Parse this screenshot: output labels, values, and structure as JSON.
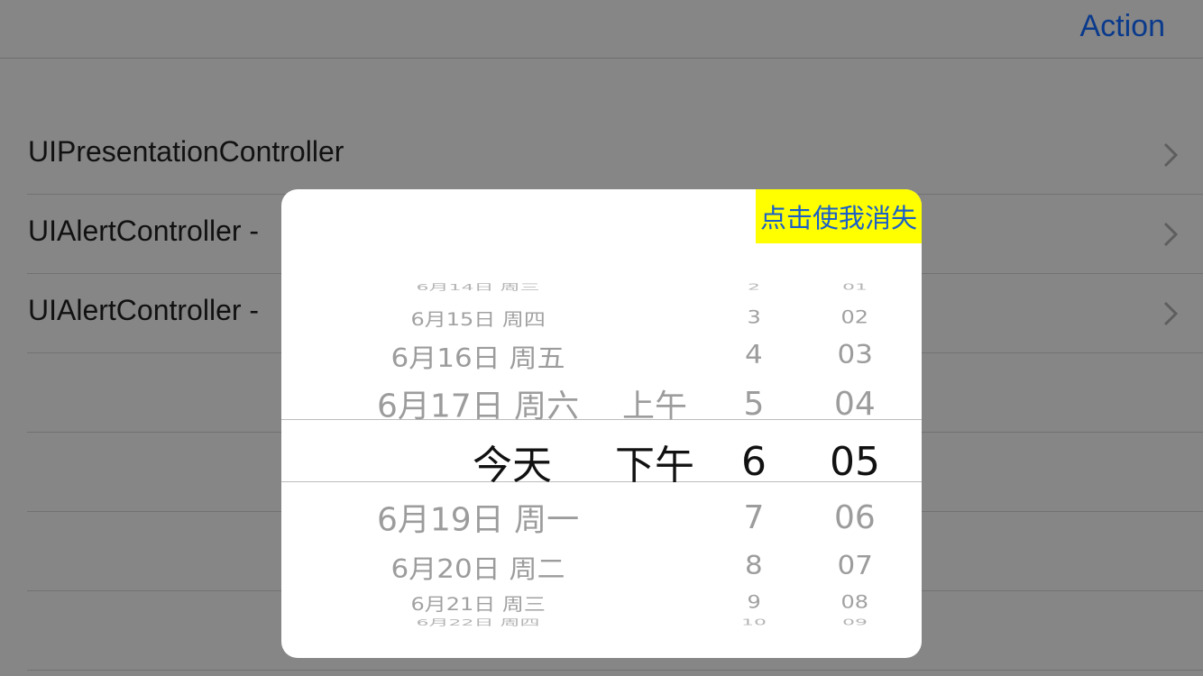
{
  "navbar": {
    "action_label": "Action"
  },
  "table": {
    "rows": [
      {
        "label": "UIPresentationController"
      },
      {
        "label": "UIAlertController -"
      },
      {
        "label": "UIAlertController -"
      }
    ]
  },
  "dialog": {
    "dismiss_label": "点击使我消失",
    "picker": {
      "date_column": [
        "6月14日 周三",
        "6月15日 周四",
        "6月16日 周五",
        "6月17日 周六",
        "今天",
        "6月19日 周一",
        "6月20日 周二",
        "6月21日 周三",
        "6月22日 周四"
      ],
      "ampm_column": [
        "上午",
        "下午"
      ],
      "hour_column": [
        "2",
        "3",
        "4",
        "5",
        "6",
        "7",
        "8",
        "9",
        "10"
      ],
      "minute_column": [
        "01",
        "02",
        "03",
        "04",
        "05",
        "06",
        "07",
        "08",
        "09"
      ],
      "selected": {
        "date": "今天",
        "ampm": "下午",
        "hour": "6",
        "minute": "05"
      }
    }
  }
}
